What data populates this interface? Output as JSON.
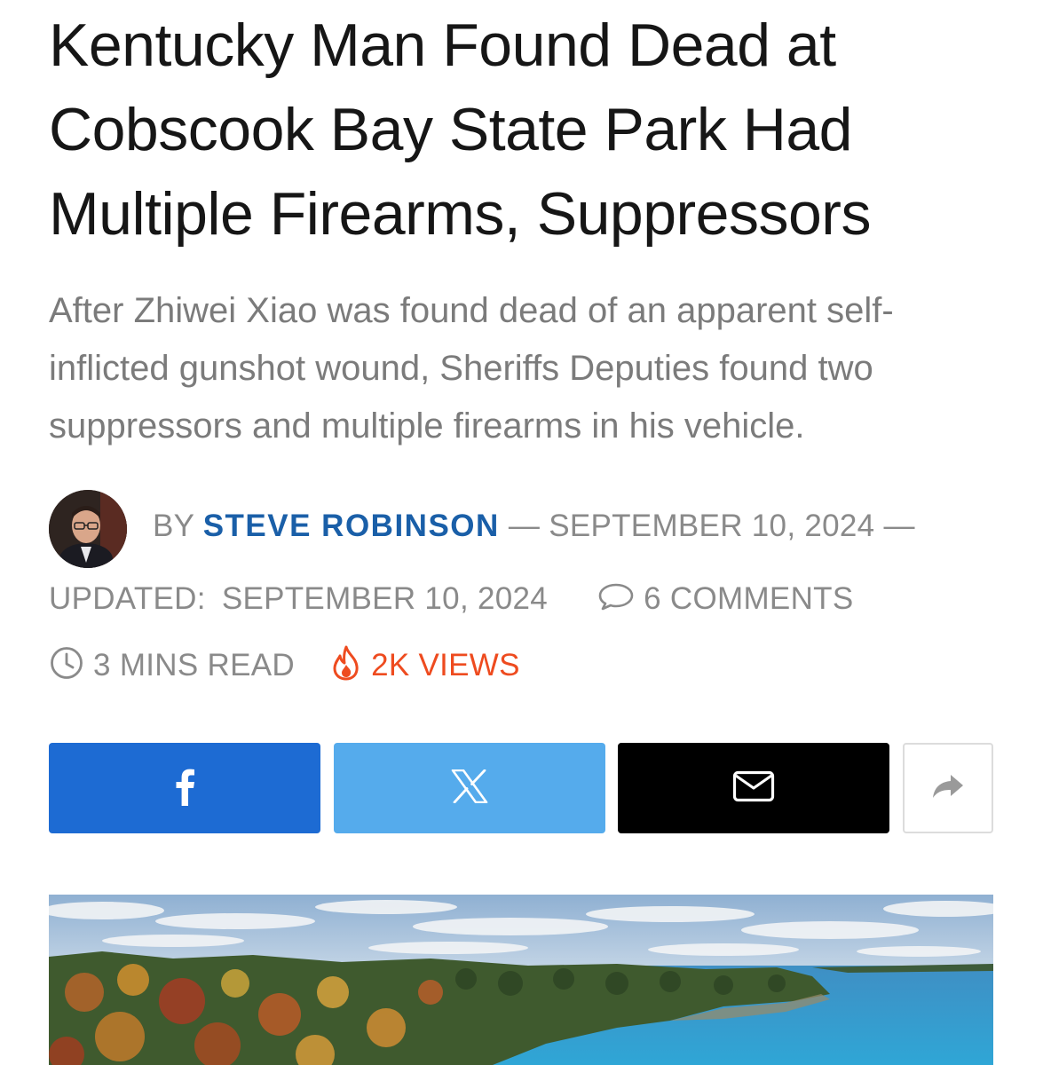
{
  "article": {
    "headline_lines": [
      "Kentucky Man Found Dead at",
      "Cobscook Bay State Park Had",
      "Multiple Firearms, Suppressors"
    ],
    "dek_lines": [
      "After Zhiwei Xiao was found dead of an apparent self-",
      "inflicted gunshot wound, Sheriffs Deputies found two",
      "suppressors and multiple firearms in his vehicle."
    ]
  },
  "byline": {
    "by_label": "BY",
    "author": "STEVE ROBINSON",
    "separator": "—",
    "published": "SEPTEMBER 10, 2024",
    "updated_label": "UPDATED:",
    "updated": "SEPTEMBER 10, 2024",
    "comments": "6 COMMENTS",
    "read_time": "3 MINS READ",
    "views": "2K VIEWS"
  },
  "share": {
    "facebook_icon": "facebook-icon",
    "x_icon": "x-icon",
    "email_icon": "envelope-icon",
    "more_icon": "share-arrow-icon"
  },
  "colors": {
    "author": "#1a5fa8",
    "views": "#ee4b1f",
    "facebook": "#1d6bd3",
    "x": "#55abec",
    "email": "#000000"
  }
}
